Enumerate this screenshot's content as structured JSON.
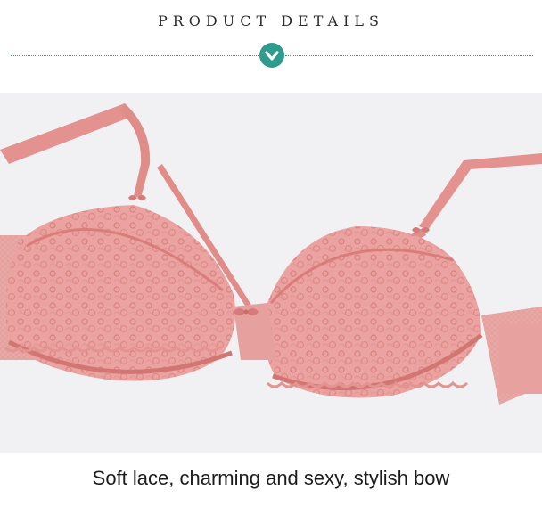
{
  "header": {
    "title": "PRODUCT DETAILS",
    "badge_icon": "checkmark-chevron-icon",
    "accent_color": "#2f9a8e"
  },
  "photo": {
    "background_color": "#f1f1f3",
    "product_color": "#e89a98"
  },
  "caption": {
    "text": "Soft lace, charming and sexy, stylish bow"
  }
}
